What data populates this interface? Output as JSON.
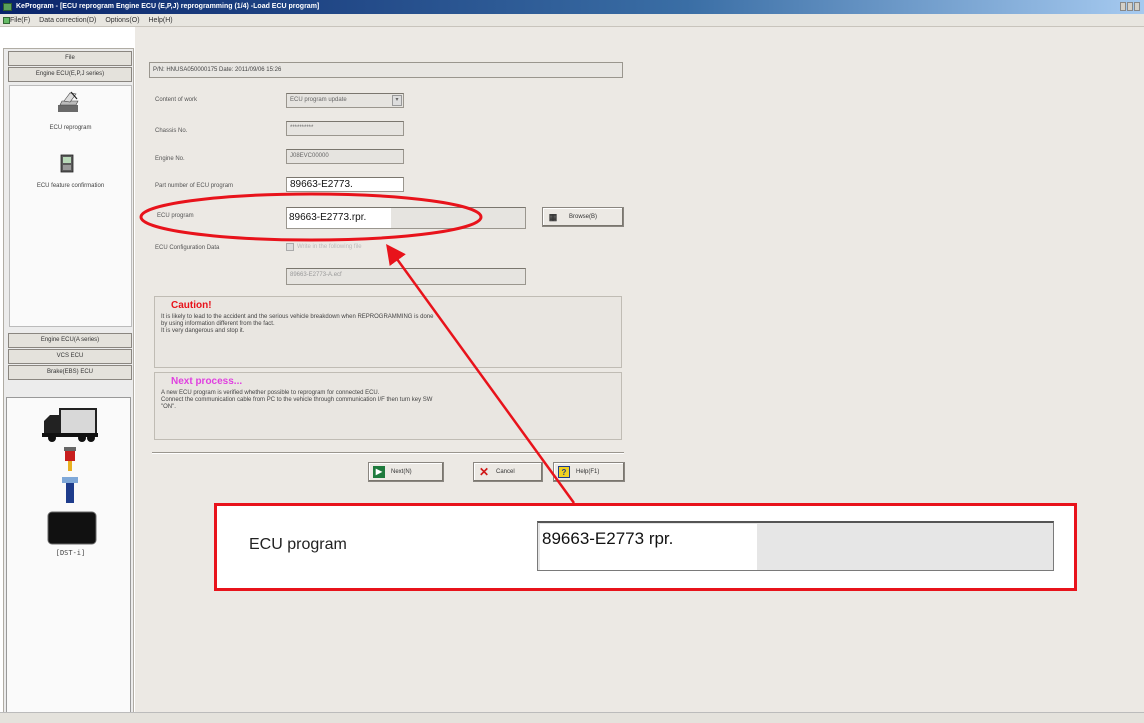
{
  "window": {
    "title": "KeProgram - [ECU reprogram Engine ECU (E,P,J) reprogramming (1/4) -Load ECU program]"
  },
  "menu": [
    {
      "label": "File(F)"
    },
    {
      "label": "Data correction(D)"
    },
    {
      "label": "Options(O)"
    },
    {
      "label": "Help(H)"
    }
  ],
  "sidebar": {
    "top_buttons": [
      "File",
      "Engine ECU(E,P,J series)"
    ],
    "items": [
      {
        "label": "ECU reprogram",
        "icon": "ecu-reprogram-icon"
      },
      {
        "label": "ECU feature confirmation",
        "icon": "ecu-feature-icon"
      }
    ],
    "bottom_buttons": [
      "Engine ECU(A series)",
      "VCS ECU",
      "Brake(EBS) ECU"
    ],
    "device_label": "[DST-i]"
  },
  "form": {
    "pn_date": "P/N: HNUSA050000175  Date: 2011/09/06 15:26",
    "content_of_work_label": "Content of work",
    "content_of_work_value": "ECU program update",
    "chassis_label": "Chassis No.",
    "chassis_value": "**********",
    "engine_label": "Engine No.",
    "engine_value": "J08EVC00000",
    "part_number_label": "Part number of ECU program",
    "part_number_value": "89663-E2773.",
    "ecu_program_label": "ECU program",
    "ecu_program_value": "89663-E2773.rpr.",
    "browse_label": "Browse(B)",
    "config_label": "ECU Configuration Data",
    "config_check_label": "Write in the following file",
    "config_value": "89663-E2773-A.ecf"
  },
  "caution": {
    "title": "Caution!",
    "lines": [
      "It is likely to lead to the accident and the serious vehicle breakdown when REPROGRAMMING is done",
      "by using information different from the fact.",
      "It is very dangerous and stop it."
    ]
  },
  "next_process": {
    "title": "Next process...",
    "lines": [
      "A new ECU program is verified whether possible to reprogram for connected ECU.",
      "Connect the communication cable from PC to the vehicle through communication I/F then turn key SW",
      "\"ON\"."
    ]
  },
  "buttons": {
    "next": "Next(N)",
    "cancel": "Cancel",
    "help": "Help(F1)"
  },
  "zoom": {
    "label": "ECU program",
    "value": "89663-E2773 rpr."
  },
  "colors": {
    "annotation": "#e8131b",
    "caution_title": "#e8131b",
    "next_title": "#e040e0"
  }
}
